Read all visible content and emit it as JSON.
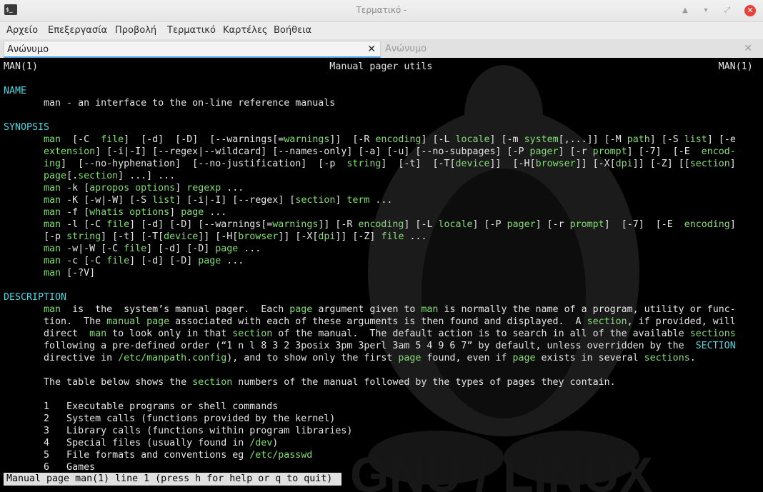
{
  "window": {
    "title": "Τερματικό -"
  },
  "menu": [
    "Αρχείο",
    "Επεξεργασία",
    "Προβολή",
    "Τερματικό",
    "Καρτέλες",
    "Βοήθεια"
  ],
  "tabs": [
    {
      "label": "Ανώνυμο",
      "active": true
    },
    {
      "label": "Ανώνυμο",
      "active": false
    }
  ],
  "terminal": {
    "lines": [
      [
        [
          "n",
          "MAN(1)                                                   Manual pager utils                                                  MAN(1)"
        ]
      ],
      [
        [
          "n",
          ""
        ]
      ],
      [
        [
          "h",
          "NAME"
        ]
      ],
      [
        [
          "n",
          "       man - an interface to the on-line reference manuals"
        ]
      ],
      [
        [
          "n",
          ""
        ]
      ],
      [
        [
          "h",
          "SYNOPSIS"
        ]
      ],
      [
        [
          "g",
          "       man"
        ],
        [
          "n",
          "  [-C  "
        ],
        [
          "g",
          "file"
        ],
        [
          "n",
          "]  [-d]  [-D]  [--warnings[="
        ],
        [
          "g",
          "warnings"
        ],
        [
          "n",
          "]]  [-R "
        ],
        [
          "g",
          "encoding"
        ],
        [
          "n",
          "] [-L "
        ],
        [
          "g",
          "locale"
        ],
        [
          "n",
          "] [-m "
        ],
        [
          "g",
          "system"
        ],
        [
          "n",
          "[,...]] [-M "
        ],
        [
          "g",
          "path"
        ],
        [
          "n",
          "] [-S "
        ],
        [
          "g",
          "list"
        ],
        [
          "n",
          "] [-e"
        ]
      ],
      [
        [
          "g",
          "       extension"
        ],
        [
          "n",
          "] [-i|-I] [--regex|--wildcard] [--names-only] [-a] [-u] [--no-subpages] [-P "
        ],
        [
          "g",
          "pager"
        ],
        [
          "n",
          "] [-r "
        ],
        [
          "g",
          "prompt"
        ],
        [
          "n",
          "] [-7]  [-E  "
        ],
        [
          "g",
          "encod-"
        ]
      ],
      [
        [
          "g",
          "       ing"
        ],
        [
          "n",
          "]  [--no-hyphenation]  [--no-justification]  [-p  "
        ],
        [
          "g",
          "string"
        ],
        [
          "n",
          "]  [-t]  [-T["
        ],
        [
          "g",
          "device"
        ],
        [
          "n",
          "]]  [-H["
        ],
        [
          "g",
          "browser"
        ],
        [
          "n",
          "]] [-X["
        ],
        [
          "g",
          "dpi"
        ],
        [
          "n",
          "]] [-Z] [["
        ],
        [
          "g",
          "section"
        ],
        [
          "n",
          "]"
        ]
      ],
      [
        [
          "g",
          "       page"
        ],
        [
          "n",
          "[."
        ],
        [
          "g",
          "section"
        ],
        [
          "n",
          "] ...] ..."
        ]
      ],
      [
        [
          "g",
          "       man"
        ],
        [
          "n",
          " -k ["
        ],
        [
          "g",
          "apropos options"
        ],
        [
          "n",
          "] "
        ],
        [
          "g",
          "regexp"
        ],
        [
          "n",
          " ..."
        ]
      ],
      [
        [
          "g",
          "       man"
        ],
        [
          "n",
          " -K [-w|-W] [-S "
        ],
        [
          "g",
          "list"
        ],
        [
          "n",
          "] [-i|-I] [--regex] ["
        ],
        [
          "g",
          "section"
        ],
        [
          "n",
          "] "
        ],
        [
          "g",
          "term"
        ],
        [
          "n",
          " ..."
        ]
      ],
      [
        [
          "g",
          "       man"
        ],
        [
          "n",
          " -f ["
        ],
        [
          "g",
          "whatis options"
        ],
        [
          "n",
          "] "
        ],
        [
          "g",
          "page"
        ],
        [
          "n",
          " ..."
        ]
      ],
      [
        [
          "g",
          "       man"
        ],
        [
          "n",
          " -l [-C "
        ],
        [
          "g",
          "file"
        ],
        [
          "n",
          "] [-d] [-D] [--warnings[="
        ],
        [
          "g",
          "warnings"
        ],
        [
          "n",
          "]] [-R "
        ],
        [
          "g",
          "encoding"
        ],
        [
          "n",
          "] [-L "
        ],
        [
          "g",
          "locale"
        ],
        [
          "n",
          "] [-P "
        ],
        [
          "g",
          "pager"
        ],
        [
          "n",
          "] [-r "
        ],
        [
          "g",
          "prompt"
        ],
        [
          "n",
          "]  [-7]  [-E  "
        ],
        [
          "g",
          "encoding"
        ],
        [
          "n",
          "]"
        ]
      ],
      [
        [
          "n",
          "       [-p "
        ],
        [
          "g",
          "string"
        ],
        [
          "n",
          "] [-t] [-T["
        ],
        [
          "g",
          "device"
        ],
        [
          "n",
          "]] [-H["
        ],
        [
          "g",
          "browser"
        ],
        [
          "n",
          "]] [-X["
        ],
        [
          "g",
          "dpi"
        ],
        [
          "n",
          "]] [-Z] "
        ],
        [
          "g",
          "file"
        ],
        [
          "n",
          " ..."
        ]
      ],
      [
        [
          "g",
          "       man"
        ],
        [
          "n",
          " -w|-W [-C "
        ],
        [
          "g",
          "file"
        ],
        [
          "n",
          "] [-d] [-D] "
        ],
        [
          "g",
          "page"
        ],
        [
          "n",
          " ..."
        ]
      ],
      [
        [
          "g",
          "       man"
        ],
        [
          "n",
          " -c [-C "
        ],
        [
          "g",
          "file"
        ],
        [
          "n",
          "] [-d] [-D] "
        ],
        [
          "g",
          "page"
        ],
        [
          "n",
          " ..."
        ]
      ],
      [
        [
          "g",
          "       man"
        ],
        [
          "n",
          " [-?V]"
        ]
      ],
      [
        [
          "n",
          ""
        ]
      ],
      [
        [
          "h",
          "DESCRIPTION"
        ]
      ],
      [
        [
          "g",
          "       man"
        ],
        [
          "n",
          "  is  the  system’s manual pager.  Each "
        ],
        [
          "g",
          "page"
        ],
        [
          "n",
          " argument given to "
        ],
        [
          "g",
          "man"
        ],
        [
          "n",
          " is normally the name of a program, utility or func-"
        ]
      ],
      [
        [
          "n",
          "       tion.  The "
        ],
        [
          "g",
          "manual page"
        ],
        [
          "n",
          " associated with each of these arguments is then found and displayed.  A "
        ],
        [
          "g",
          "section"
        ],
        [
          "n",
          ", if provided, will"
        ]
      ],
      [
        [
          "n",
          "       direct  "
        ],
        [
          "g",
          "man"
        ],
        [
          "n",
          " to look only in that "
        ],
        [
          "g",
          "section"
        ],
        [
          "n",
          " of the manual.  The default action is to search in all of the available "
        ],
        [
          "g",
          "sections"
        ]
      ],
      [
        [
          "n",
          "       following a pre-defined order (“1 n l 8 3 2 3posix 3pm 3perl 3am 5 4 9 6 7” by default, unless overridden by the  "
        ],
        [
          "c",
          "SECTION"
        ]
      ],
      [
        [
          "n",
          "       directive in "
        ],
        [
          "g",
          "/etc/manpath.config"
        ],
        [
          "n",
          "), and to show only the first "
        ],
        [
          "g",
          "page"
        ],
        [
          "n",
          " found, even if "
        ],
        [
          "g",
          "page"
        ],
        [
          "n",
          " exists in several "
        ],
        [
          "g",
          "sections"
        ],
        [
          "n",
          "."
        ]
      ],
      [
        [
          "n",
          ""
        ]
      ],
      [
        [
          "n",
          "       The table below shows the "
        ],
        [
          "g",
          "section"
        ],
        [
          "n",
          " numbers of the manual followed by the types of pages they contain."
        ]
      ],
      [
        [
          "n",
          ""
        ]
      ],
      [
        [
          "n",
          "       1   Executable programs or shell commands"
        ]
      ],
      [
        [
          "n",
          "       2   System calls (functions provided by the kernel)"
        ]
      ],
      [
        [
          "n",
          "       3   Library calls (functions within program libraries)"
        ]
      ],
      [
        [
          "n",
          "       4   Special files (usually found in "
        ],
        [
          "g",
          "/dev"
        ],
        [
          "n",
          ")"
        ]
      ],
      [
        [
          "n",
          "       5   File formats and conventions eg "
        ],
        [
          "g",
          "/etc/passwd"
        ]
      ],
      [
        [
          "n",
          "       6   Games"
        ]
      ]
    ],
    "status": "Manual page man(1) line 1 (press h for help or q to quit)"
  }
}
